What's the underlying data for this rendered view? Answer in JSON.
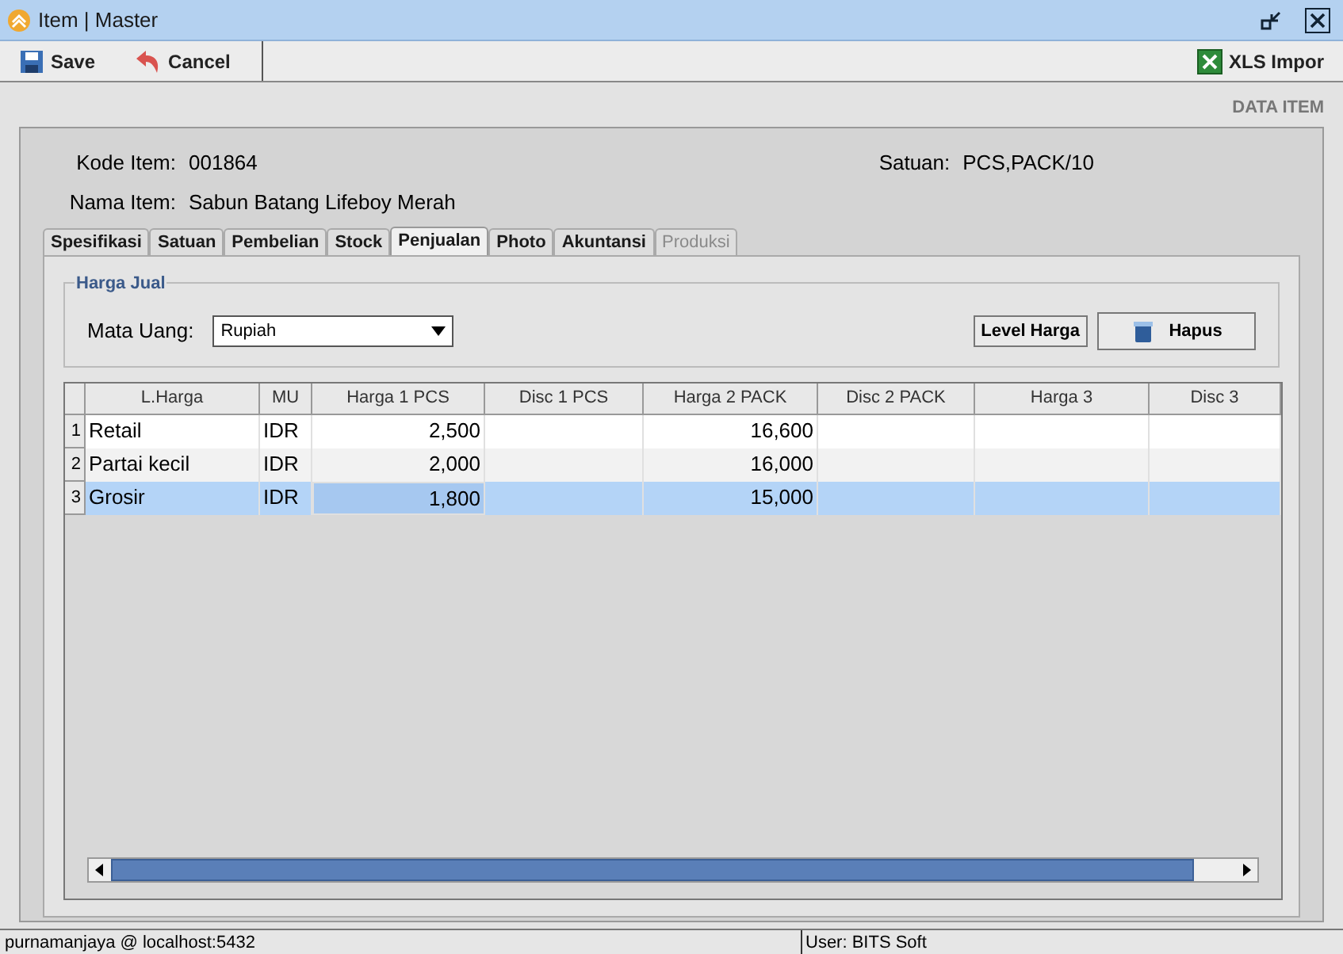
{
  "window": {
    "title": "Item | Master"
  },
  "toolbar": {
    "left": [
      {
        "label": "Save",
        "kind": "save"
      },
      {
        "label": "Cancel",
        "kind": "cancel"
      }
    ],
    "right": [
      {
        "label": "XLS Impor",
        "kind": "excel"
      }
    ]
  },
  "section_title": "DATA ITEM",
  "fields": [
    {
      "label": "Kode Item:",
      "value": "001864"
    },
    {
      "label": "Nama Item:",
      "value": "Sabun Batang Lifeboy Merah"
    },
    {
      "label": "Satuan:",
      "value": "PCS,PACK/10"
    }
  ],
  "tabs": [
    {
      "label": "Spesifikasi",
      "selected": false,
      "disabled": false
    },
    {
      "label": "Satuan",
      "selected": false,
      "disabled": false
    },
    {
      "label": "Pembelian",
      "selected": false,
      "disabled": false
    },
    {
      "label": "Stock",
      "selected": false,
      "disabled": false
    },
    {
      "label": "Penjualan",
      "selected": true,
      "disabled": false
    },
    {
      "label": "Photo",
      "selected": false,
      "disabled": false
    },
    {
      "label": "Akuntansi",
      "selected": false,
      "disabled": false
    },
    {
      "label": "Produksi",
      "selected": false,
      "disabled": true
    }
  ],
  "group": {
    "title": "Harga Jual",
    "currency_label": "Mata Uang:",
    "currency_value": "Rupiah",
    "buttons": [
      {
        "label": "Level Harga",
        "kind": "plain"
      },
      {
        "label": "Hapus",
        "kind": "delete"
      }
    ]
  },
  "table": {
    "columns": [
      "L.Harga",
      "MU",
      "Harga 1 PCS",
      "Disc 1 PCS",
      "Harga 2 PACK",
      "Disc 2 PACK",
      "Harga 3",
      "Disc 3"
    ],
    "rows": [
      {
        "number": "1",
        "selected": false,
        "cells": [
          "Retail",
          "IDR",
          "2,500",
          "",
          "16,600",
          "",
          "",
          ""
        ]
      },
      {
        "number": "2",
        "selected": false,
        "cells": [
          "Partai kecil",
          "IDR",
          "2,000",
          "",
          "16,000",
          "",
          "",
          ""
        ]
      },
      {
        "number": "3",
        "selected": true,
        "cells": [
          "Grosir",
          "IDR",
          "1,800",
          "",
          "15,000",
          "",
          "",
          ""
        ]
      }
    ]
  },
  "status_bar": [
    "purnamanjaya @ localhost:5432",
    "User: BITS Soft"
  ]
}
